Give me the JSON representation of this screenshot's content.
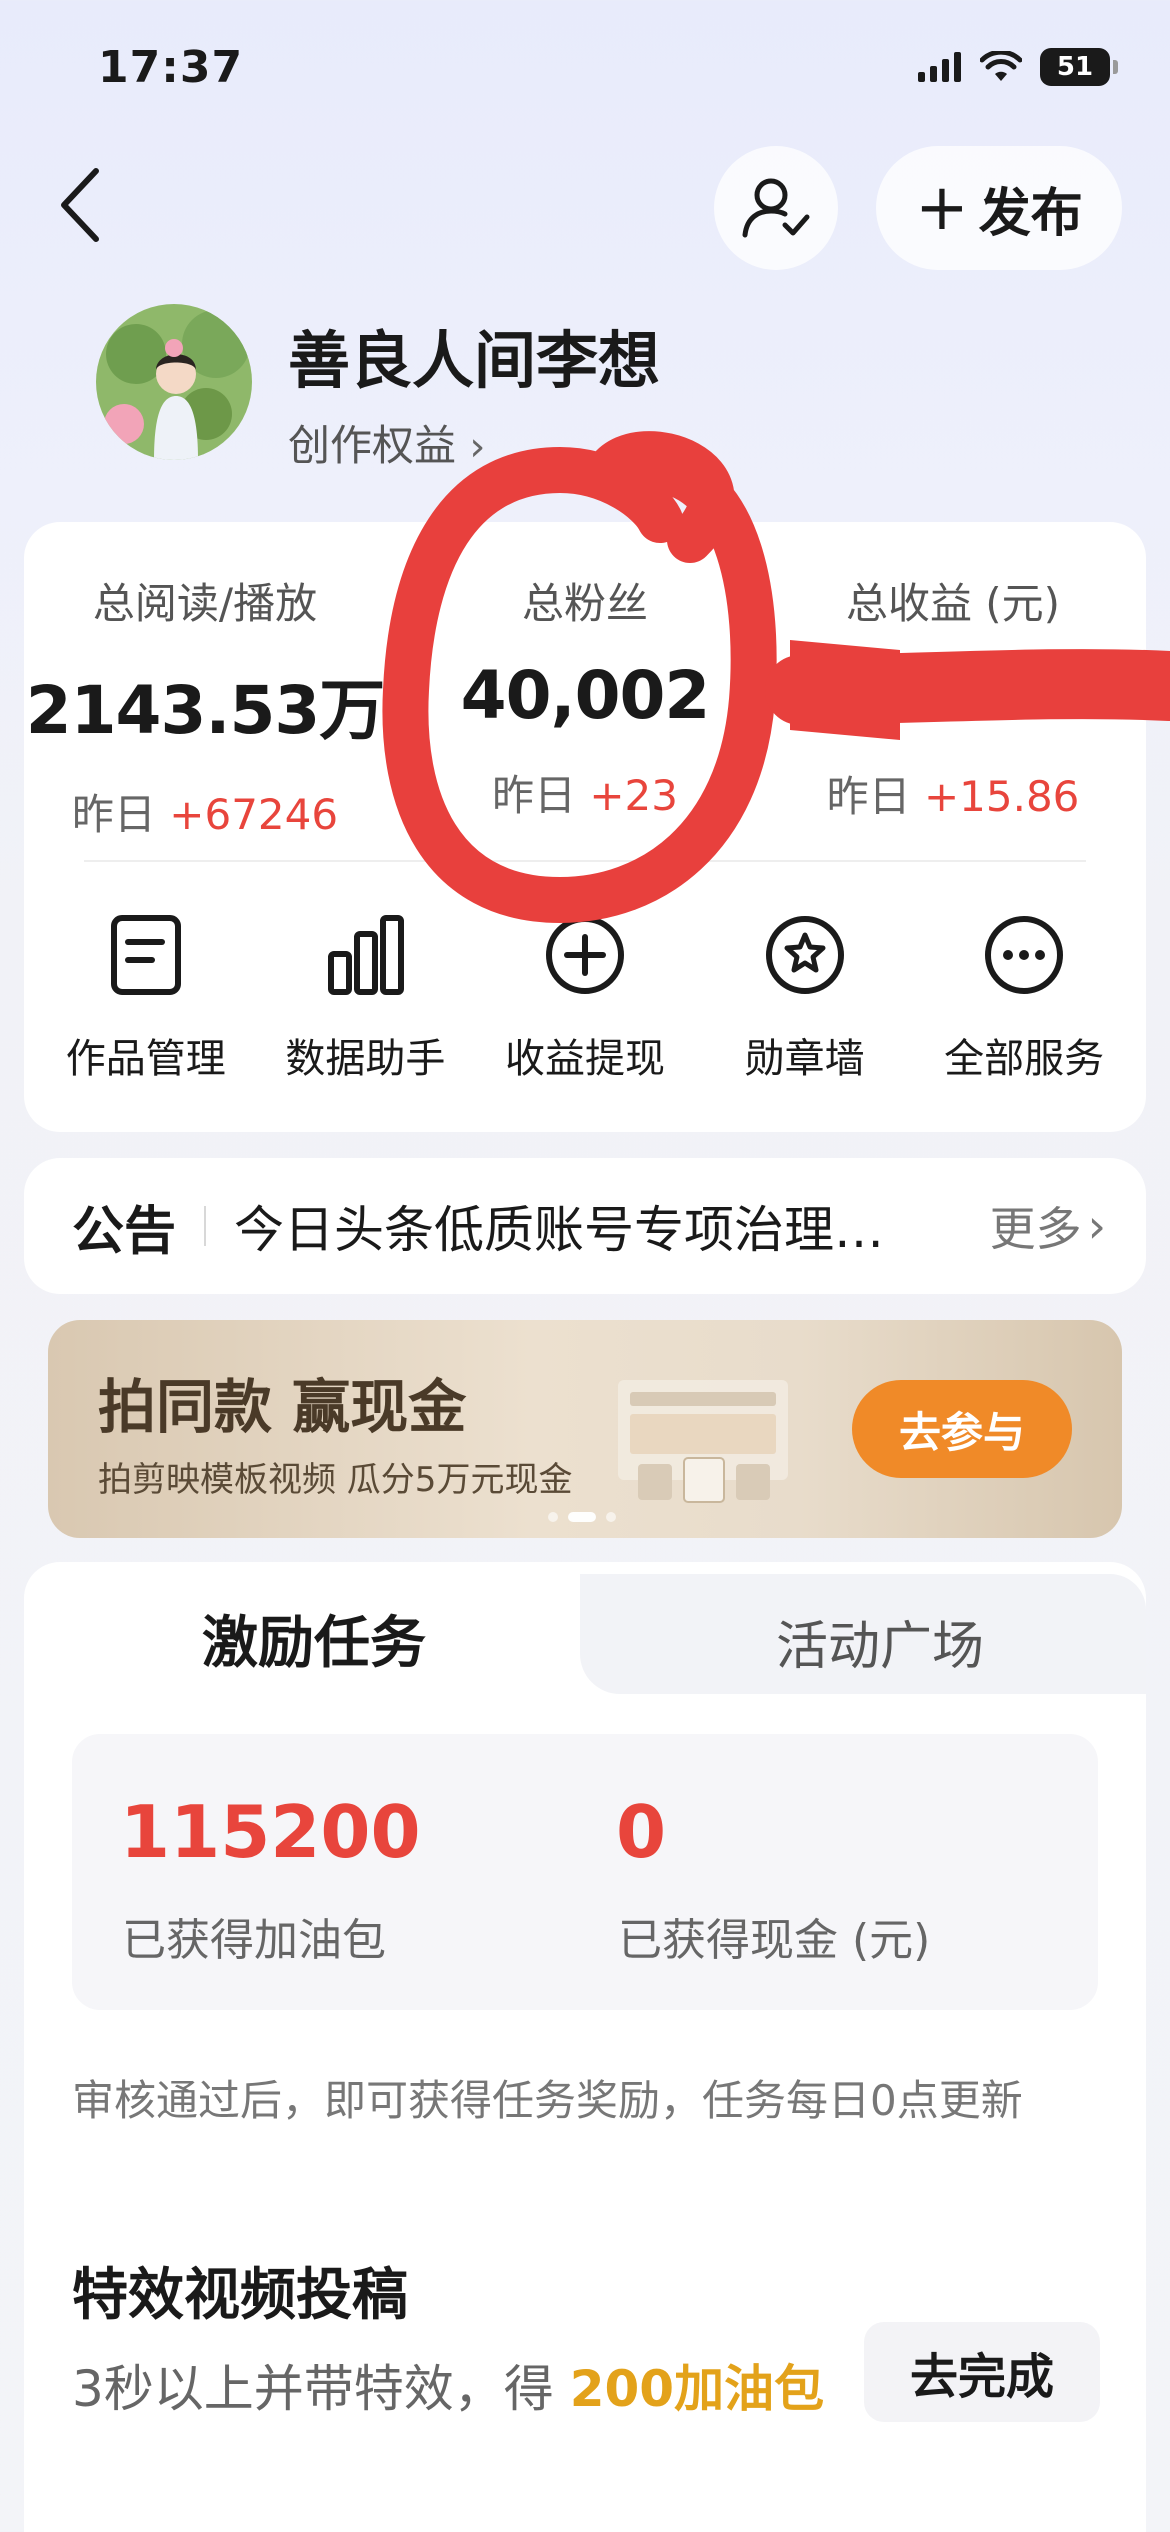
{
  "status_bar": {
    "time": "17:37",
    "battery": "51",
    "icons": [
      "signal-icon",
      "wifi-icon",
      "battery-icon"
    ]
  },
  "nav": {
    "back_icon": "chevron-left-icon",
    "follow_icon": "user-follow-icon",
    "publish_label": "发布",
    "publish_icon": "plus-icon"
  },
  "profile": {
    "name": "善良人间李想",
    "link_label": "创作权益"
  },
  "stats": [
    {
      "label": "总阅读/播放",
      "value": "2143.53万",
      "delta_prefix": "昨日",
      "delta": "+67246"
    },
    {
      "label": "总粉丝",
      "value": "40,002",
      "delta_prefix": "昨日",
      "delta": "+23"
    },
    {
      "label": "总收益 (元)",
      "value": "",
      "delta_prefix": "昨日",
      "delta": "+15.86"
    }
  ],
  "services": [
    {
      "label": "作品管理",
      "icon": "document-icon"
    },
    {
      "label": "数据助手",
      "icon": "bar-chart-icon"
    },
    {
      "label": "收益提现",
      "icon": "withdraw-icon"
    },
    {
      "label": "勋章墙",
      "icon": "medal-icon"
    },
    {
      "label": "全部服务",
      "icon": "more-icon"
    }
  ],
  "notice": {
    "title": "公告",
    "text": "今日头条低质账号专项治理…",
    "more": "更多"
  },
  "banner": {
    "title": "拍同款 赢现金",
    "subtitle": "拍剪映模板视频 瓜分5万元现金",
    "cta": "去参与"
  },
  "tabs": {
    "active": "激励任务",
    "inactive": "活动广场"
  },
  "earnings": [
    {
      "value": "115200",
      "label": "已获得加油包"
    },
    {
      "value": "0",
      "label": "已获得现金 (元)"
    }
  ],
  "rule_text": "审核通过后，即可获得任务奖励，任务每日0点更新",
  "task": {
    "title": "特效视频投稿",
    "desc_prefix": "3秒以上并带特效，得 ",
    "reward": "200加油包",
    "button": "去完成"
  },
  "colors": {
    "accent_red": "#e8453c",
    "cta_orange": "#f08a28",
    "reward_gold": "#e3a21a",
    "annotation_red": "#e8403d"
  }
}
